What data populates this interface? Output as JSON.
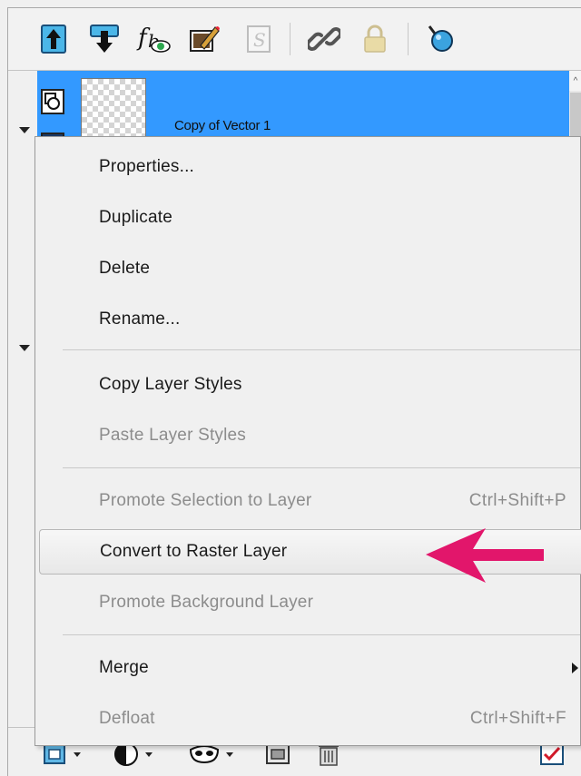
{
  "toolbar": {
    "buttons": [
      {
        "name": "move-layer-up-icon"
      },
      {
        "name": "move-layer-down-icon"
      },
      {
        "name": "layer-styles-fx-icon"
      },
      {
        "name": "edit-properties-icon"
      },
      {
        "name": "link-group-disabled-icon"
      },
      {
        "name": "link-layer-icon"
      },
      {
        "name": "lock-transparency-icon"
      },
      {
        "name": "pin-highlight-icon"
      }
    ]
  },
  "layer": {
    "name": "Copy of Vector 1"
  },
  "context_menu": {
    "items": [
      {
        "label": "Properties...",
        "enabled": true
      },
      {
        "label": "Duplicate",
        "enabled": true
      },
      {
        "label": "Delete",
        "enabled": true
      },
      {
        "label": "Rename...",
        "enabled": true
      },
      {
        "label": "Copy Layer Styles",
        "enabled": true
      },
      {
        "label": "Paste Layer Styles",
        "enabled": false
      },
      {
        "label": "Promote Selection to Layer",
        "enabled": false,
        "shortcut": "Ctrl+Shift+P"
      },
      {
        "label": "Convert to Raster Layer",
        "enabled": true,
        "highlighted": true
      },
      {
        "label": "Promote Background Layer",
        "enabled": false
      },
      {
        "label": "Merge",
        "enabled": true,
        "has_submenu": true
      },
      {
        "label": "Defloat",
        "enabled": false,
        "shortcut": "Ctrl+Shift+F"
      }
    ]
  },
  "colors": {
    "selection": "#3399ff",
    "callout_arrow": "#e2166b",
    "disabled_text": "#8c8c8c"
  }
}
